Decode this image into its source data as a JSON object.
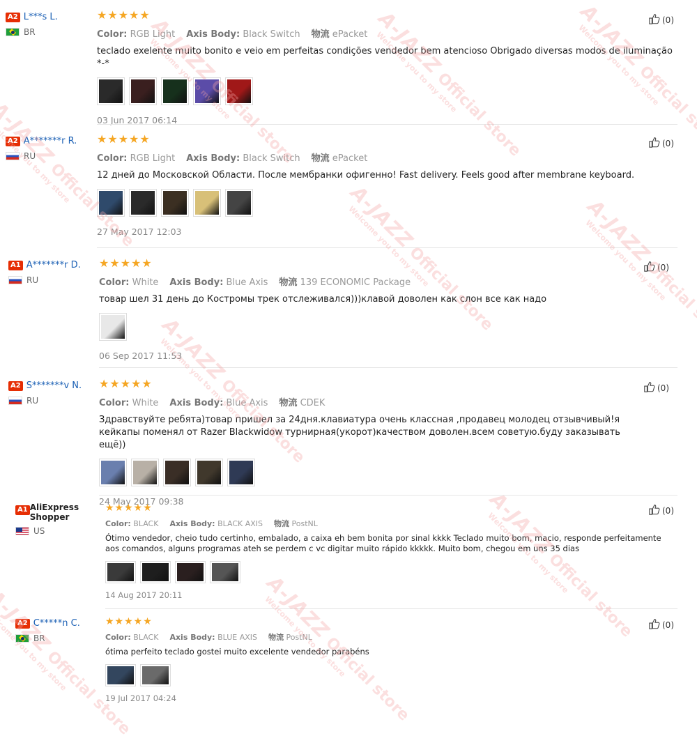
{
  "colors": {
    "star": "#f5a623",
    "badge": "#e62e04",
    "username": "#1a5fb4"
  },
  "watermark": {
    "brand": "A-JAZZ",
    "store": "Official store",
    "welcome": "Welcome you to my store"
  },
  "reviews": [
    {
      "badge": "A2",
      "name": "L***s L.",
      "country": "BR",
      "flag": "flag-br",
      "stars": "★★★★★",
      "meta": [
        [
          "Color:",
          "RGB Light"
        ],
        [
          "Axis Body:",
          "Black Switch"
        ],
        [
          "物流",
          "ePacket"
        ]
      ],
      "text": "teclado exelente muito bonito e veio em perfeitas condições vendedor bem atencioso Obrigado diversas modos de iluminação *-*",
      "thumbs": [
        "#2a2a2a",
        "#3a1f1f",
        "#16301c",
        "#5b4ca8",
        "#a01818"
      ],
      "date": "03 Jun 2017 06:14",
      "helpful": "(0)"
    },
    {
      "badge": "A2",
      "name": "A*******r R.",
      "country": "RU",
      "flag": "flag-ru",
      "stars": "★★★★★",
      "meta": [
        [
          "Color:",
          "RGB Light"
        ],
        [
          "Axis Body:",
          "Black Switch"
        ],
        [
          "物流",
          "ePacket"
        ]
      ],
      "text": "12 дней до Московской Области. После мембранки офигенно! Fast delivery. Feels good after membrane keyboard.",
      "thumbs": [
        "#2f4a6b",
        "#2a2a2a",
        "#3b2f22",
        "#d8c078",
        "#444444"
      ],
      "date": "27 May 2017 12:03",
      "helpful": "(0)"
    },
    {
      "badge": "A1",
      "name": "A*******r D.",
      "country": "RU",
      "flag": "flag-ru",
      "stars": "★★★★★",
      "meta": [
        [
          "Color:",
          "White"
        ],
        [
          "Axis Body:",
          "Blue Axis"
        ],
        [
          "物流",
          "139 ECONOMIC Package"
        ]
      ],
      "text": "товар шел 31 день до Костромы трек отслеживался)))клавой доволен как слон все как надо",
      "thumbs": [
        "#e8e8e8"
      ],
      "date": "06 Sep 2017 11:53",
      "helpful": "(0)"
    },
    {
      "badge": "A2",
      "name": "S*******v N.",
      "country": "RU",
      "flag": "flag-ru",
      "stars": "★★★★★",
      "meta": [
        [
          "Color:",
          "White"
        ],
        [
          "Axis Body:",
          "Blue Axis"
        ],
        [
          "物流",
          "CDEK"
        ]
      ],
      "text": "Здравствуйте ребята)товар пришел за 24дня.клавиатура очень классная ,продавец молодец отзывчивый!я кейкапы поменял от Razer Blackwidow турнирная(укорот)качеством доволен.всем советую.буду заказывать ещё))",
      "thumbs": [
        "#6a7fae",
        "#b8b0a6",
        "#3a2e26",
        "#40382c",
        "#2f3a55"
      ],
      "date": "24 May 2017 09:38",
      "helpful": "(0)"
    },
    {
      "badge": "A1",
      "name": "AliExpress Shopper",
      "country": "US",
      "flag": "flag-us",
      "stars": "★★★★★",
      "meta": [
        [
          "Color:",
          "BLACK"
        ],
        [
          "Axis Body:",
          "BLACK AXIS"
        ],
        [
          "物流",
          "PostNL"
        ]
      ],
      "text": "Ótimo vendedor, cheio tudo certinho, embalado, a caixa eh bem bonita por sinal kkkk Teclado muito bom, macio, responde perfeitamente aos comandos, alguns programas ateh se perdem c vc digitar muito rápido kkkkk. Muito bom, chegou em uns 35 dias",
      "thumbs": [
        "#3a3a3a",
        "#1e1e1e",
        "#2a1f1f",
        "#555555"
      ],
      "date": "14 Aug 2017 20:11",
      "helpful": "(0)"
    },
    {
      "badge": "A2",
      "name": "C*****n C.",
      "country": "BR",
      "flag": "flag-br",
      "stars": "★★★★★",
      "meta": [
        [
          "Color:",
          "BLACK"
        ],
        [
          "Axis Body:",
          "BLUE AXIS"
        ],
        [
          "物流",
          "PostNL"
        ]
      ],
      "text": "ótima perfeito teclado gostei muito excelente vendedor parabéns",
      "thumbs": [
        "#33465e",
        "#6a6a6a"
      ],
      "date": "19 Jul 2017 04:24",
      "helpful": "(0)"
    }
  ]
}
